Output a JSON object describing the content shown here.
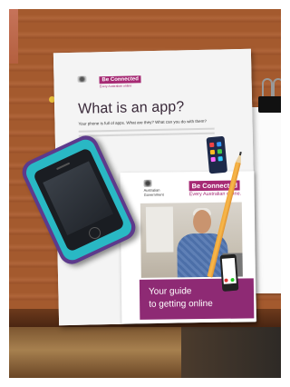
{
  "scene": {
    "description_objects": [
      "phone-case",
      "pencil",
      "binder-clip",
      "notepad",
      "booklet"
    ]
  },
  "booklet": {
    "cover": {
      "header_badge": "Be Connected",
      "header_badge_sub": "Every Australian online",
      "heading": "What is an app?",
      "subline": "Your phone is full of apps. What are they? What can you do with them?"
    },
    "inner_card": {
      "gov_label": "Australian Government",
      "badge": "Be Connected",
      "tagline": "Every Australian online.",
      "guide_line_1": "Your guide",
      "guide_line_2": "to getting online"
    }
  },
  "colors": {
    "brand_magenta": "#a62a74",
    "guide_banner": "#8e2a74",
    "phone_case_outer": "#5d3a8c",
    "phone_case_inner": "#29b8c4",
    "pencil": "#f0a73a"
  }
}
